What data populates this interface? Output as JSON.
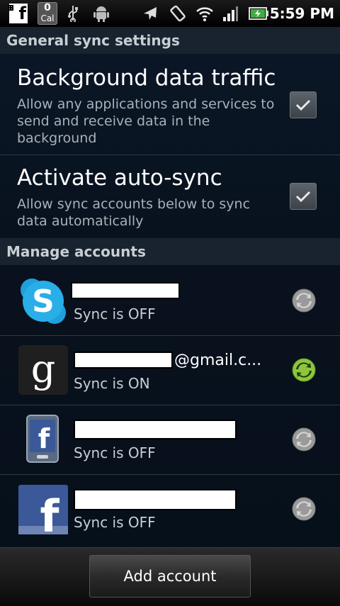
{
  "status_bar": {
    "time": "5:59 PM",
    "cal_count": "0",
    "cal_label": "Cal",
    "fb_glyph": "f",
    "icons": [
      "facebook-notification-icon",
      "calendar-notification-icon",
      "usb-icon",
      "android-debug-icon",
      "airplane-icon",
      "screen-rotate-icon",
      "wifi-icon",
      "signal-icon",
      "battery-icon"
    ]
  },
  "general_header": "General sync settings",
  "background_data": {
    "title": "Background data traffic",
    "description": "Allow any applications and services to send and receive data in the background",
    "checked": true
  },
  "auto_sync": {
    "title": "Activate auto-sync",
    "description": "Allow sync accounts below to sync data automatically",
    "checked": true
  },
  "manage_header": "Manage accounts",
  "accounts": [
    {
      "service": "skype",
      "suffix": "",
      "status": "Sync is OFF",
      "syncing": false
    },
    {
      "service": "google",
      "suffix": "@gmail.c...",
      "status": "Sync is ON",
      "syncing": true
    },
    {
      "service": "facebook-sync",
      "suffix": "",
      "status": "Sync is OFF",
      "syncing": false
    },
    {
      "service": "facebook",
      "suffix": "",
      "status": "Sync is OFF",
      "syncing": false
    }
  ],
  "add_account_label": "Add account",
  "colors": {
    "sync_on": "#8cc63f",
    "sync_off": "#9a9a9a",
    "header_bg": "#18232f"
  }
}
